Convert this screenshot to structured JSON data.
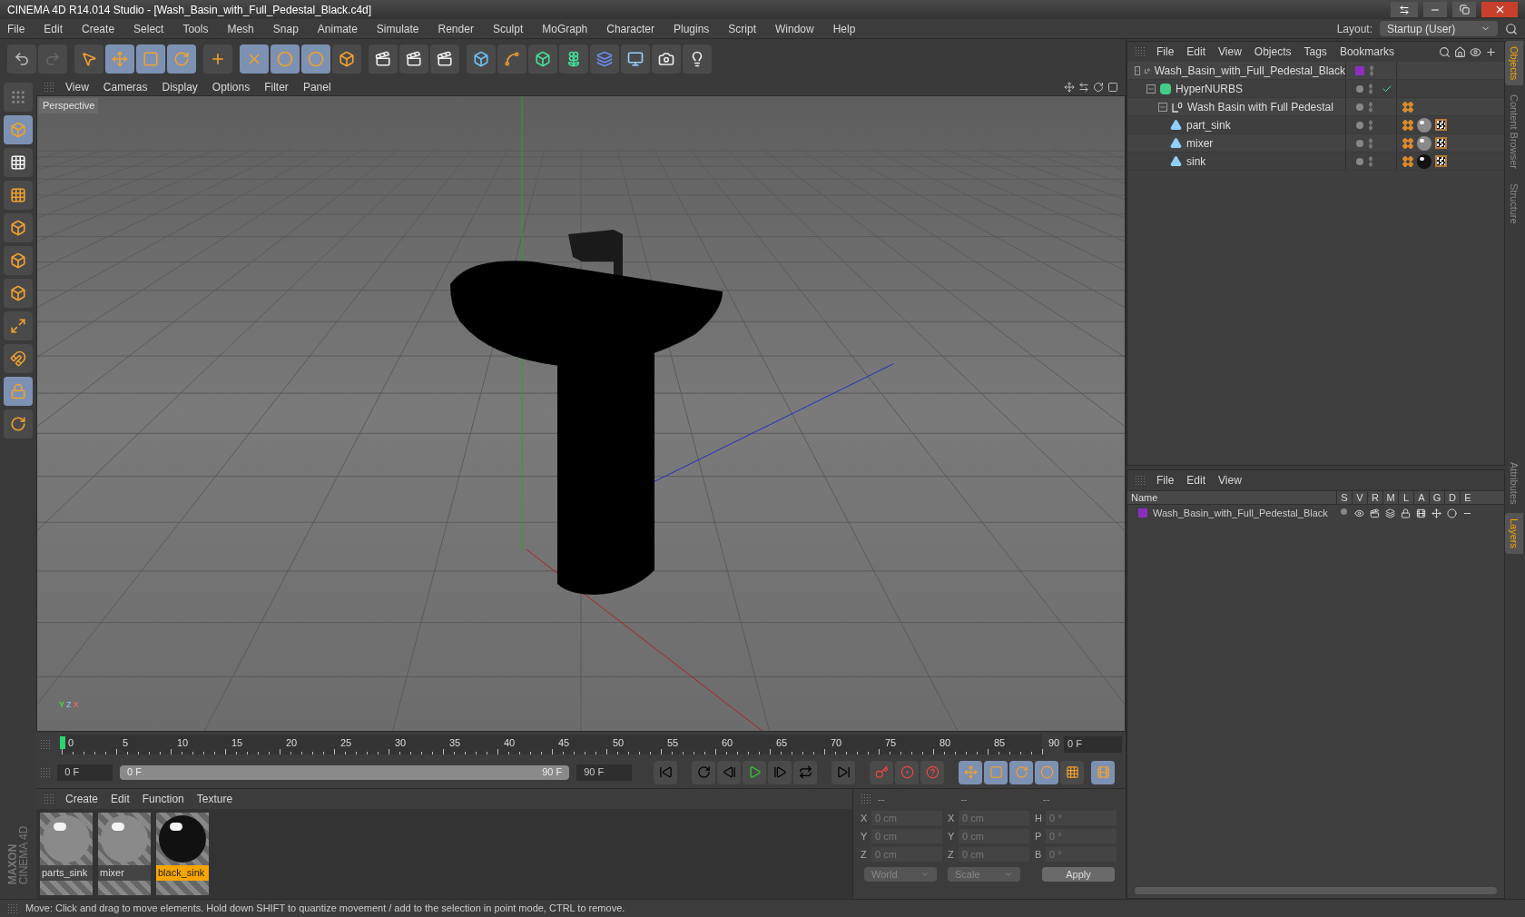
{
  "window": {
    "title": "CINEMA 4D R14.014 Studio - [Wash_Basin_with_Full_Pedestal_Black.c4d]"
  },
  "menu_bar": [
    "File",
    "Edit",
    "Create",
    "Select",
    "Tools",
    "Mesh",
    "Snap",
    "Animate",
    "Simulate",
    "Render",
    "Sculpt",
    "MoGraph",
    "Character",
    "Plugins",
    "Script",
    "Window",
    "Help"
  ],
  "layout": {
    "label": "Layout:",
    "value": "Startup (User)"
  },
  "viewport": {
    "menu": [
      "View",
      "Cameras",
      "Display",
      "Options",
      "Filter",
      "Panel"
    ],
    "label": "Perspective",
    "axis_labels": [
      "Y",
      "Z",
      "X"
    ]
  },
  "timeline": {
    "ticks": [
      "0",
      "5",
      "10",
      "15",
      "20",
      "25",
      "30",
      "35",
      "40",
      "45",
      "50",
      "55",
      "60",
      "65",
      "70",
      "75",
      "80",
      "85",
      "90"
    ],
    "current_frame": "0 F"
  },
  "playback": {
    "level": 1,
    "start_frame": "0 F",
    "range_start": "0 F",
    "range_end": "90 F",
    "end_frame": "90 F"
  },
  "materials": {
    "menu": [
      "Create",
      "Edit",
      "Function",
      "Texture"
    ],
    "items": [
      {
        "name": "parts_sink",
        "color": "#8a8a8a",
        "selected": false
      },
      {
        "name": "mixer",
        "color": "#8a8a8a",
        "selected": false
      },
      {
        "name": "black_sink",
        "color": "#111111",
        "selected": true
      }
    ]
  },
  "coordinates": {
    "headers": [
      "--",
      "--",
      "--"
    ],
    "rows": [
      {
        "cells": [
          {
            "axis": "X",
            "value": "0 cm"
          },
          {
            "axis": "X",
            "value": "0 cm"
          },
          {
            "axis": "H",
            "value": "0 °"
          }
        ]
      },
      {
        "cells": [
          {
            "axis": "Y",
            "value": "0 cm"
          },
          {
            "axis": "Y",
            "value": "0 cm"
          },
          {
            "axis": "P",
            "value": "0 °"
          }
        ]
      },
      {
        "cells": [
          {
            "axis": "Z",
            "value": "0 cm"
          },
          {
            "axis": "Z",
            "value": "0 cm"
          },
          {
            "axis": "B",
            "value": "0 °"
          }
        ]
      }
    ],
    "dropdowns": [
      "World",
      "Scale"
    ],
    "apply": "Apply",
    "disabled": true
  },
  "brand": [
    "MAXON",
    "CINEMA 4D"
  ],
  "status_bar": "Move: Click and drag to move elements. Hold down SHIFT to quantize movement / add to the selection in point mode, CTRL to remove.",
  "objects": {
    "menu": [
      "File",
      "Edit",
      "View",
      "Objects",
      "Tags",
      "Bookmarks"
    ],
    "tree": [
      {
        "name": "Wash_Basin_with_Full_Pedestal_Black",
        "kind": "null",
        "color": "#8a2fc0",
        "children": [
          {
            "name": "HyperNURBS",
            "kind": "generator",
            "enabled": true,
            "children": [
              {
                "name": "Wash Basin with Full Pedestal",
                "kind": "null",
                "tags": [
                  {
                    "kind": "phong"
                  }
                ],
                "children": [
                  {
                    "name": "part_sink",
                    "kind": "polygon",
                    "tags": [
                      {
                        "kind": "phong"
                      },
                      {
                        "kind": "material",
                        "color": "#8a8a8a"
                      },
                      {
                        "kind": "uvw"
                      }
                    ]
                  },
                  {
                    "name": "mixer",
                    "kind": "polygon",
                    "tags": [
                      {
                        "kind": "phong"
                      },
                      {
                        "kind": "material",
                        "color": "#8a8a8a"
                      },
                      {
                        "kind": "uvw"
                      }
                    ]
                  },
                  {
                    "name": "sink",
                    "kind": "polygon",
                    "tags": [
                      {
                        "kind": "phong"
                      },
                      {
                        "kind": "material",
                        "color": "#111111"
                      },
                      {
                        "kind": "uvw"
                      }
                    ]
                  }
                ]
              }
            ]
          }
        ]
      }
    ]
  },
  "layers": {
    "menu": [
      "File",
      "Edit",
      "View"
    ],
    "columns": [
      "Name",
      "S",
      "V",
      "R",
      "M",
      "L",
      "A",
      "G",
      "D",
      "E"
    ],
    "rows": [
      {
        "name": "Wash_Basin_with_Full_Pedestal_Black",
        "color": "#8a2fc0"
      }
    ]
  },
  "side_tabs_top": [
    {
      "label": "Objects",
      "selected": true
    },
    {
      "label": "Content Browser",
      "selected": false
    },
    {
      "label": "Structure",
      "selected": false
    }
  ],
  "side_tabs_bottom": [
    {
      "label": "Attributes",
      "selected": false
    },
    {
      "label": "Layers",
      "selected": true
    }
  ]
}
